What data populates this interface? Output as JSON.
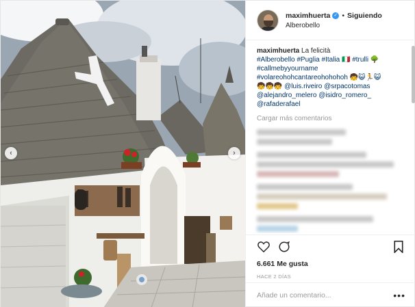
{
  "header": {
    "username": "maximhuerta",
    "separator": "•",
    "follow_label": "Siguiendo",
    "location": "Alberobello"
  },
  "caption": {
    "username": "maximhuerta",
    "title_text": "La felicità",
    "line2": "#Alberobello #Puglia #Italia 🇮🇹 #trulli 🌳",
    "line3": "#callmebyyourname",
    "line4": "#volareohohcantareohohohoh 🧒😺🏃😺",
    "line5": "🧒🧒🧒 @luis.riveiro @srpacotomas",
    "line6": "@alejandro_melero @isidro_romero_",
    "line7": "@rafaderafael"
  },
  "load_more_label": "Cargar más comentarios",
  "likes_text": "6.661 Me gusta",
  "timestamp": "HACE 2 DÍAS",
  "comment_input": {
    "placeholder": "Añade un comentario..."
  },
  "more_label": "•••",
  "icons": {
    "like": "heart-icon",
    "comment": "comment-icon",
    "save": "bookmark-icon",
    "verified": "verified-badge-icon",
    "prev": "chevron-left-icon",
    "next": "chevron-right-icon"
  },
  "colors": {
    "link": "#003569",
    "verified": "#3897f0",
    "muted": "#999999",
    "text": "#262626"
  },
  "carousel": {
    "prev_glyph": "‹",
    "next_glyph": "›"
  }
}
